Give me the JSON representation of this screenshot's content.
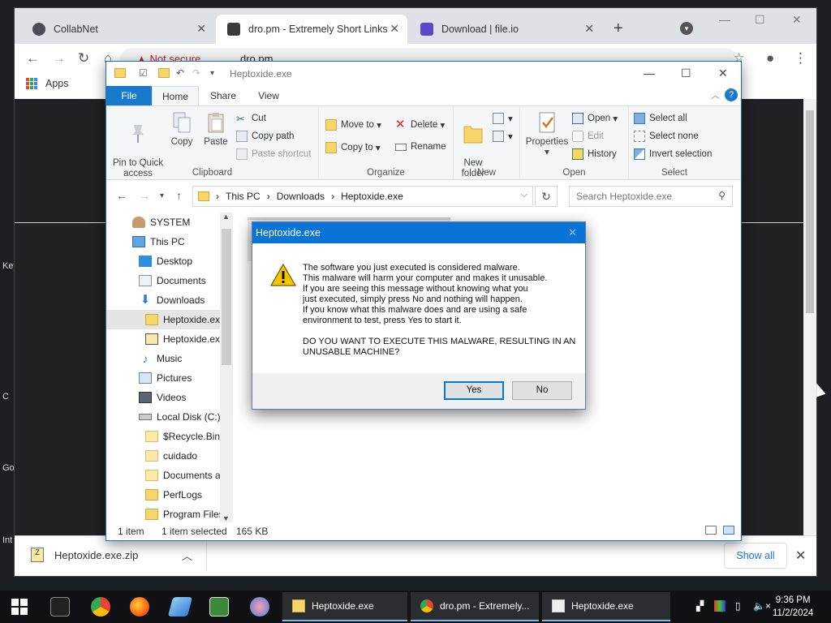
{
  "desktop": {
    "left_labels": [
      "Key",
      "C",
      "Go",
      "Int"
    ]
  },
  "chrome": {
    "tabs": [
      {
        "title": "CollabNet",
        "favicon_color": "#4a4f57"
      },
      {
        "title": "dro.pm - Extremely Short Links",
        "favicon_color": "#3b3b3b"
      },
      {
        "title": "Download | file.io",
        "favicon_color": "#5b47c9"
      }
    ],
    "new_tab_label": "+",
    "address": {
      "security_label": "Not secure",
      "url": "dro.pm"
    },
    "bookmarks": {
      "apps_label": "Apps"
    }
  },
  "download_bar": {
    "file_name": "Heptoxide.exe.zip",
    "show_all_label": "Show all"
  },
  "explorer": {
    "title": "Heptoxide.exe",
    "ribbon_tabs": [
      "File",
      "Home",
      "Share",
      "View"
    ],
    "clipboard": {
      "pin_label": "Pin to Quick\naccess",
      "copy_label": "Copy",
      "paste_label": "Paste",
      "cut_label": "Cut",
      "copy_path_label": "Copy path",
      "paste_shortcut_label": "Paste shortcut",
      "group_label": "Clipboard"
    },
    "organize": {
      "move_to_label": "Move to",
      "copy_to_label": "Copy to",
      "delete_label": "Delete",
      "rename_label": "Rename",
      "group_label": "Organize"
    },
    "new": {
      "new_folder_label": "New\nfolder",
      "group_label": "New"
    },
    "open": {
      "properties_label": "Properties",
      "open_label": "Open",
      "edit_label": "Edit",
      "history_label": "History",
      "group_label": "Open"
    },
    "select": {
      "select_all_label": "Select all",
      "select_none_label": "Select none",
      "invert_label": "Invert selection",
      "group_label": "Select"
    },
    "breadcrumb": [
      "This PC",
      "Downloads",
      "Heptoxide.exe"
    ],
    "search_placeholder": "Search Heptoxide.exe",
    "nav_items": [
      {
        "label": "SYSTEM",
        "icon": "user-icon"
      },
      {
        "label": "This PC",
        "icon": "computer-icon"
      },
      {
        "label": "Desktop",
        "icon": "desktop-icon"
      },
      {
        "label": "Documents",
        "icon": "documents-icon"
      },
      {
        "label": "Downloads",
        "icon": "download-icon"
      },
      {
        "label": "Heptoxide.exe",
        "icon": "folder-icon"
      },
      {
        "label": "Heptoxide.exe",
        "icon": "zip-icon"
      },
      {
        "label": "Music",
        "icon": "music-icon"
      },
      {
        "label": "Pictures",
        "icon": "pictures-icon"
      },
      {
        "label": "Videos",
        "icon": "videos-icon"
      },
      {
        "label": "Local Disk (C:)",
        "icon": "disk-icon"
      },
      {
        "label": "$Recycle.Bin",
        "icon": "folder-icon"
      },
      {
        "label": "cuidado",
        "icon": "folder-icon"
      },
      {
        "label": "Documents a",
        "icon": "folder-icon"
      },
      {
        "label": "PerfLogs",
        "icon": "folder-icon"
      },
      {
        "label": "Program Files",
        "icon": "folder-icon"
      }
    ],
    "status": {
      "items": "1 item",
      "selected": "1 item selected",
      "size": "165 KB"
    }
  },
  "dialog": {
    "title": "Heptoxide.exe",
    "message": "The software you just executed is considered malware.\nThis malware will harm your computer and makes it unusable.\nIf you are seeing this message without knowing what you\njust executed, simply press No and nothing will happen.\nIf you know what this malware does and are using a safe\nenvironment to test, press Yes to start it.\n\nDO YOU WANT TO EXECUTE THIS MALWARE, RESULTING IN AN\nUNUSABLE MACHINE?",
    "yes_label": "Yes",
    "no_label": "No"
  },
  "taskbar": {
    "apps": [
      {
        "label": "Heptoxide.exe",
        "icon": "folder-icon"
      },
      {
        "label": "dro.pm - Extremely...",
        "icon": "chrome-icon"
      },
      {
        "label": "Heptoxide.exe",
        "icon": "app-window-icon"
      }
    ],
    "time": "9:36 PM",
    "date": "11/2/2024"
  }
}
